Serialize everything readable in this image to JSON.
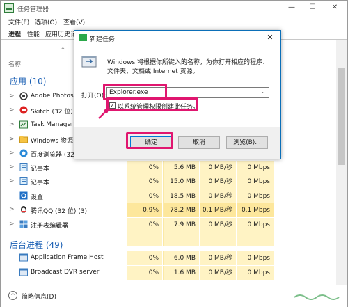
{
  "window": {
    "title": "任务管理器",
    "min": "—",
    "max": "☐",
    "close": "✕"
  },
  "menu": [
    "文件(F)",
    "选项(O)",
    "查看(V)"
  ],
  "tabs": [
    "进程",
    "性能",
    "应用历史记"
  ],
  "columns": {
    "name": "名称",
    "sort_arrow": "^"
  },
  "groups": {
    "apps": "应用 (10)",
    "background": "后台进程 (49)"
  },
  "rows": [
    {
      "name": "Adobe Photos",
      "icon": "photoshop-icon",
      "cpu": "",
      "mem": "",
      "disk": "",
      "net": ""
    },
    {
      "name": "Skitch (32 位)",
      "icon": "skitch-icon",
      "cpu": "",
      "mem": "",
      "disk": "",
      "net": ""
    },
    {
      "name": "Task Manager",
      "icon": "task-manager-icon",
      "cpu": "",
      "mem": "",
      "disk": "",
      "net": ""
    },
    {
      "name": "Windows 资源",
      "icon": "explorer-icon",
      "cpu": "",
      "mem": "",
      "disk": "",
      "net": ""
    },
    {
      "name": "百度浏览器 (32",
      "icon": "baidu-browser-icon",
      "cpu": "",
      "mem": "",
      "disk": "",
      "net": ""
    },
    {
      "name": "记事本",
      "icon": "notepad-icon",
      "cpu": "0%",
      "mem": "5.6 MB",
      "disk": "0 MB/秒",
      "net": "0 Mbps"
    },
    {
      "name": "记事本",
      "icon": "notepad-icon",
      "cpu": "0%",
      "mem": "15.0 MB",
      "disk": "0 MB/秒",
      "net": "0 Mbps"
    },
    {
      "name": "设置",
      "icon": "settings-icon",
      "cpu": "0%",
      "mem": "18.5 MB",
      "disk": "0 MB/秒",
      "net": "0 Mbps"
    },
    {
      "name": "腾讯QQ (32 位) (3)",
      "icon": "qq-icon",
      "cpu": "0.9%",
      "mem": "78.2 MB",
      "disk": "0.1 MB/秒",
      "net": "0.1 Mbps"
    },
    {
      "name": "注册表编辑器",
      "icon": "regedit-icon",
      "cpu": "0%",
      "mem": "7.9 MB",
      "disk": "0 MB/秒",
      "net": "0 Mbps"
    }
  ],
  "bg_rows": [
    {
      "name": "Application Frame Host",
      "icon": "app-frame-icon",
      "cpu": "0%",
      "mem": "6.0 MB",
      "disk": "0 MB/秒",
      "net": "0 Mbps"
    },
    {
      "name": "Broadcast DVR server",
      "icon": "dvr-icon",
      "cpu": "0%",
      "mem": "1.6 MB",
      "disk": "0 MB/秒",
      "net": "0 Mbps"
    }
  ],
  "footer": {
    "label": "简略信息(D)"
  },
  "dialog": {
    "title": "新建任务",
    "close": "✕",
    "description": "Windows 将根据你所键入的名称，为你打开相应的程序、文件夹、文档或 Internet 资源。",
    "open_label": "打开(O):",
    "input_value": "Explorer.exe",
    "admin_label": "以系统管理权限创建此任务。",
    "admin_checked": "✓",
    "ok": "确定",
    "cancel": "取消",
    "browse": "浏览(B)..."
  },
  "colors": {
    "accent": "#1a5fb4",
    "annotation": "#e0166f",
    "cell_bg": "#fff3c4"
  }
}
